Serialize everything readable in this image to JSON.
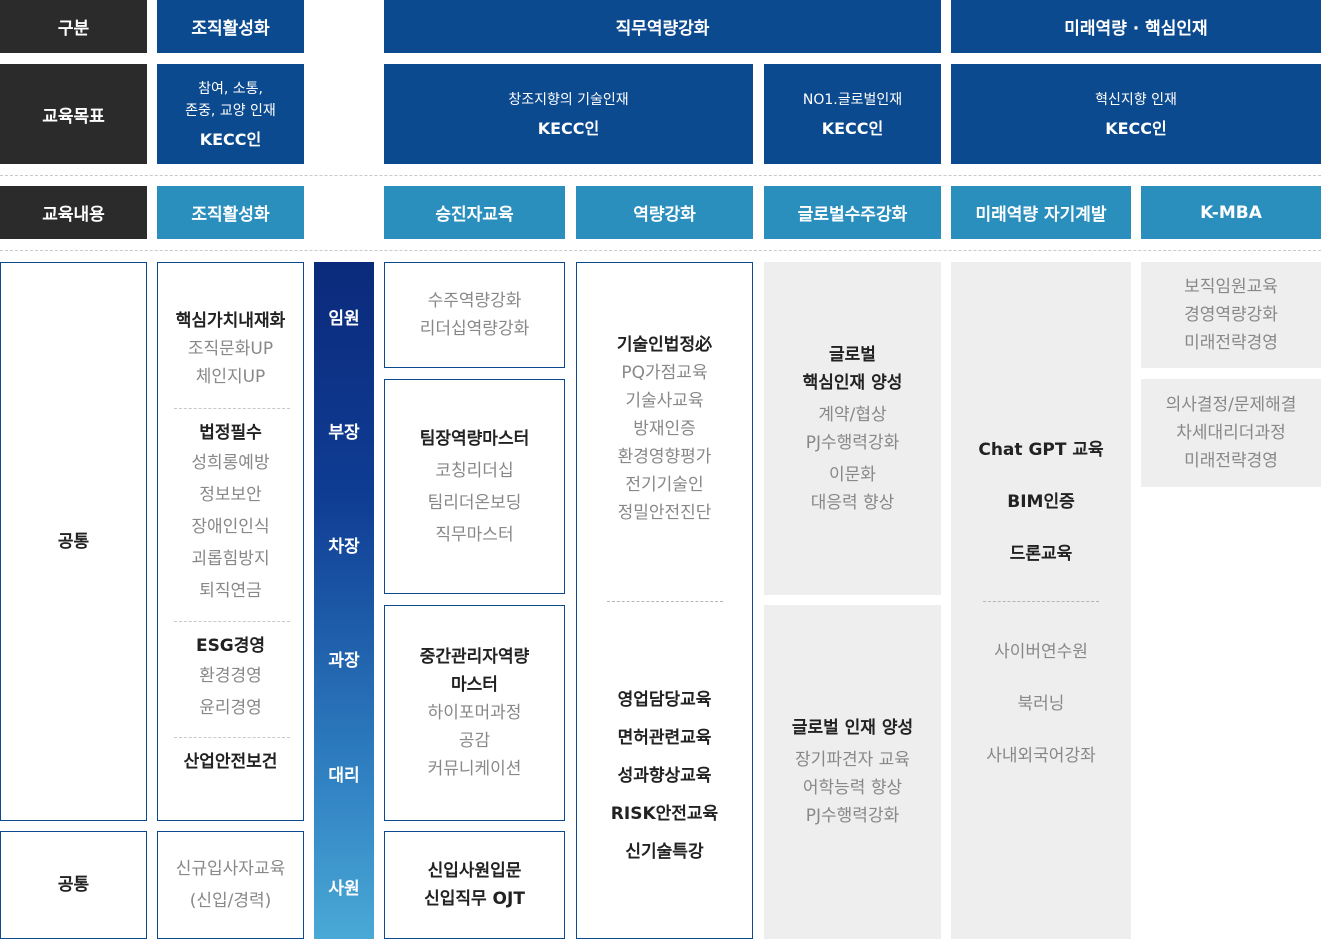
{
  "row_labels": {
    "category": "구분",
    "goal": "교육목표",
    "content": "교육내용",
    "common_1": "공통",
    "common_2": "공통"
  },
  "categories": {
    "org": "조직활성화",
    "job": "직무역량강화",
    "future": "미래역량 · 핵심인재"
  },
  "goals": {
    "org": {
      "line1": "참여, 소통,",
      "line2": "존중, 교양 인재",
      "title": "KECC인"
    },
    "creative": {
      "line1": "창조지향의 기술인재",
      "title": "KECC인"
    },
    "global": {
      "line1": "NO1.글로벌인재",
      "title": "KECC인"
    },
    "innovative": {
      "line1": "혁신지향 인재",
      "title": "KECC인"
    }
  },
  "contents": {
    "org": "조직활성화",
    "promotion": "승진자교육",
    "competency": "역량강화",
    "global": "글로벌수주강화",
    "future": "미래역량 자기계발",
    "kmba": "K-MBA"
  },
  "levels": [
    "임원",
    "부장",
    "차장",
    "과장",
    "대리",
    "사원"
  ],
  "org_col": {
    "g1_title": "핵심가치내재화",
    "g1_items": [
      "조직문화UP",
      "체인지UP"
    ],
    "g2_title": "법정필수",
    "g2_items": [
      "성희롱예방",
      "정보보안",
      "장애인인식",
      "괴롭힘방지",
      "퇴직연금"
    ],
    "g3_title": "ESG경영",
    "g3_items": [
      "환경경영",
      "윤리경영"
    ],
    "g4_title": "산업안전보건",
    "new_items": [
      "신규입사자교육",
      "(신입/경력)"
    ]
  },
  "promotion_col": {
    "exec_items": [
      "수주역량강화",
      "리더십역량강화"
    ],
    "leader_title": "팀장역량마스터",
    "leader_items": [
      "코칭리더십",
      "팀리더온보딩",
      "직무마스터"
    ],
    "mid_title1": "중간관리자역량",
    "mid_title2": "마스터",
    "mid_items": [
      "하이포머과정",
      "공감",
      "커뮤니케이션"
    ],
    "new_title1": "신입사원입문",
    "new_title2": "신입직무 OJT"
  },
  "competency_col": {
    "top_title": "기술인법정必",
    "top_items": [
      "PQ가점교육",
      "기술사교육",
      "방재인증",
      "환경영향평가",
      "전기기술인",
      "정밀안전진단"
    ],
    "bottom_items": [
      "영업담당교육",
      "면허관련교육",
      "성과향상교육",
      "RISK안전교육",
      "신기술특강"
    ]
  },
  "global_col": {
    "top_title1": "글로벌",
    "top_title2": "핵심인재 양성",
    "top_items": [
      "계약/협상",
      "PJ수행력강화"
    ],
    "top_items2": [
      "이문화",
      "대응력 향상"
    ],
    "bottom_title": "글로벌 인재 양성",
    "bottom_items": [
      "장기파견자 교육",
      "어학능력 향상",
      "PJ수행력강화"
    ]
  },
  "future_col": {
    "top_items": [
      "Chat GPT 교육",
      "BIM인증",
      "드론교육"
    ],
    "bottom_items": [
      "사이버연수원",
      "북러닝",
      "사내외국어강좌"
    ]
  },
  "kmba_col": {
    "box1": [
      "보직임원교육",
      "경영역량강화",
      "미래전략경영"
    ],
    "box2": [
      "의사결정/문제해결",
      "차세대리더과정",
      "미래전략경영"
    ]
  }
}
